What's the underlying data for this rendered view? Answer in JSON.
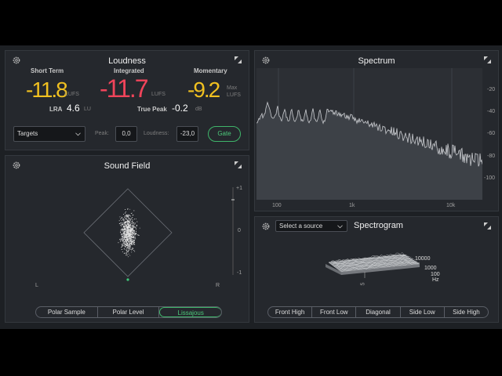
{
  "loudness": {
    "title": "Loudness",
    "short_term_label": "Short Term",
    "short_term_value": "-11.8",
    "short_term_unit": "LUFS",
    "integrated_label": "Integrated",
    "integrated_value": "-11.7",
    "integrated_unit": "LUFS",
    "momentary_label": "Momentary",
    "momentary_value": "-9.2",
    "momentary_unit1": "Max",
    "momentary_unit2": "LUFS",
    "lra_label": "LRA",
    "lra_value": "4.6",
    "lra_unit": "LU",
    "true_peak_label": "True Peak",
    "true_peak_value": "-0.2",
    "true_peak_unit": "dB",
    "targets_select": "Targets",
    "peak_label": "Peak:",
    "peak_value": "0,0",
    "loudness_label": "Loudness:",
    "loudness_value": "-23,0",
    "gate_button": "Gate",
    "colors": {
      "short_term": "#f0c020",
      "integrated": "#f0445a",
      "momentary": "#f0c020"
    }
  },
  "sound_field": {
    "title": "Sound Field",
    "scale": [
      "+1",
      "0",
      "-1"
    ],
    "left_label": "L",
    "right_label": "R",
    "modes": [
      "Polar Sample",
      "Polar Level",
      "Lissajous"
    ],
    "active_mode": "Lissajous"
  },
  "spectrum": {
    "title": "Spectrum",
    "x_ticks": [
      "100",
      "1k",
      "10k"
    ],
    "y_ticks": [
      "-20",
      "-40",
      "-60",
      "-80",
      "-100"
    ]
  },
  "spectrogram": {
    "title": "Spectrogram",
    "source_select": "Select a source",
    "freq_labels": [
      "10000",
      "1000",
      "100"
    ],
    "freq_unit": "Hz",
    "time_label": "5",
    "views": [
      "Front High",
      "Front Low",
      "Diagonal",
      "Side Low",
      "Side High"
    ]
  }
}
